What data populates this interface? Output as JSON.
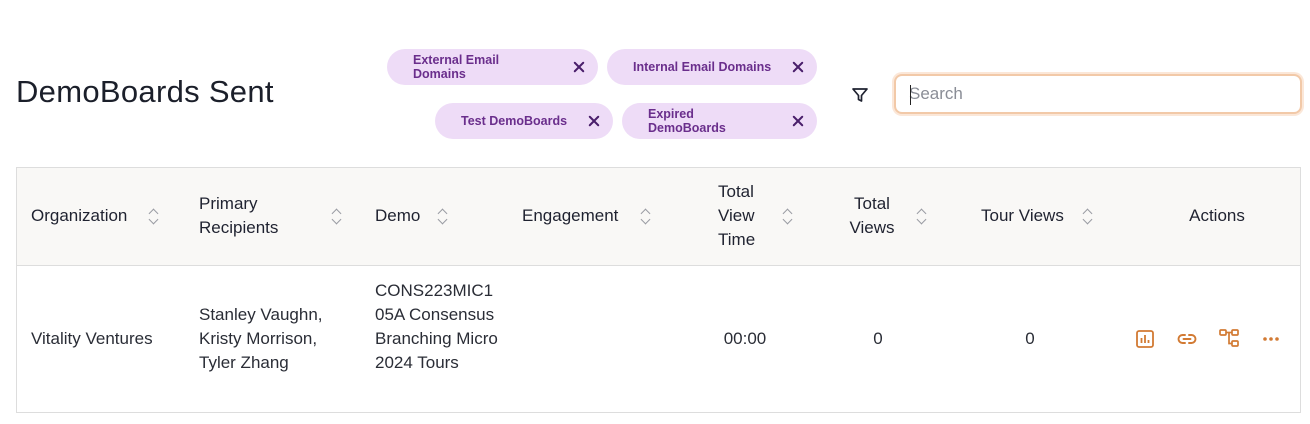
{
  "header": {
    "title": "DemoBoards Sent"
  },
  "filters": {
    "chips": [
      {
        "label": "External Email Domains"
      },
      {
        "label": "Internal Email Domains"
      },
      {
        "label": "Test DemoBoards"
      },
      {
        "label": "Expired DemoBoards"
      }
    ]
  },
  "search": {
    "placeholder": "Search",
    "value": ""
  },
  "table": {
    "columns": [
      {
        "label": "Organization",
        "sortable": true
      },
      {
        "label": "Primary Recipients",
        "sortable": true
      },
      {
        "label": "Demo",
        "sortable": true
      },
      {
        "label": "Engagement",
        "sortable": true
      },
      {
        "label": "Total View Time",
        "sortable": true
      },
      {
        "label": "Total Views",
        "sortable": true
      },
      {
        "label": "Tour Views",
        "sortable": true
      },
      {
        "label": "Actions",
        "sortable": false
      }
    ],
    "rows": [
      {
        "organization": "Vitality Ventures",
        "recipients": "Stanley Vaughn, Kristy Morrison, Tyler Zhang",
        "demo": "CONS223MIC105A Consensus Branching Micro 2024 Tours",
        "engagement": "",
        "total_view_time": "00:00",
        "total_views": "0",
        "tour_views": "0",
        "actions": [
          "chart-icon",
          "link-icon",
          "branch-icon",
          "more-icon"
        ]
      }
    ]
  },
  "colors": {
    "chip_bg": "#eedcf7",
    "chip_text": "#6a2e8c",
    "action_icon": "#d27a33",
    "header_bg": "#f9f8f6",
    "search_focus": "#f2c9a8"
  }
}
